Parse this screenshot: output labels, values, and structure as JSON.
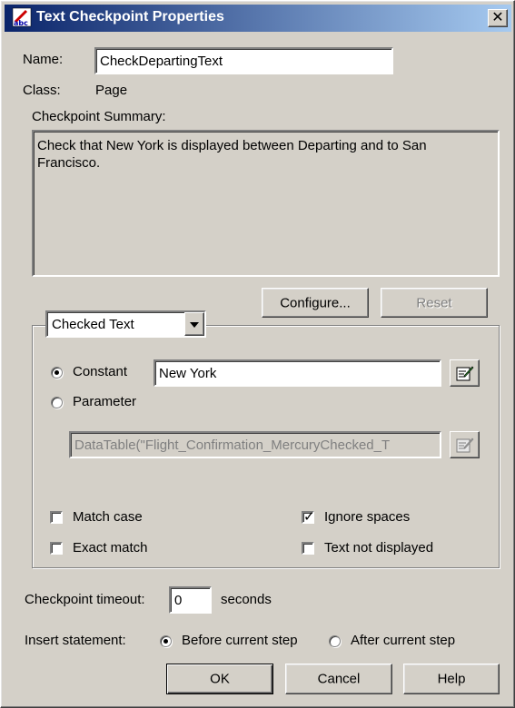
{
  "window": {
    "title": "Text Checkpoint Properties",
    "close_glyph": "✕"
  },
  "name": {
    "label": "Name:",
    "value": "CheckDepartingText"
  },
  "class": {
    "label": "Class:",
    "value": "Page"
  },
  "summary": {
    "label": "Checkpoint Summary:",
    "text": "Check that New York is displayed between Departing and to San Francisco."
  },
  "buttons": {
    "configure": "Configure...",
    "reset": "Reset",
    "ok": "OK",
    "cancel": "Cancel",
    "help": "Help"
  },
  "checked_text": {
    "selected": "Checked Text",
    "constant_label": "Constant",
    "constant_value": "New York",
    "parameter_label": "Parameter",
    "parameter_value": "DataTable(\"Flight_Confirmation_MercuryChecked_T",
    "source": "constant"
  },
  "options": {
    "match_case": {
      "label": "Match case",
      "checked": false
    },
    "exact_match": {
      "label": "Exact match",
      "checked": false
    },
    "ignore_spaces": {
      "label": "Ignore spaces",
      "checked": true
    },
    "text_not_displayed": {
      "label": "Text not displayed",
      "checked": false
    }
  },
  "timeout": {
    "label": "Checkpoint timeout:",
    "value": "0",
    "unit": "seconds"
  },
  "insert": {
    "label": "Insert statement:",
    "before": "Before current step",
    "after": "After current step",
    "selected": "before"
  },
  "icons": {
    "app": "abc-checkpoint-icon",
    "edit": "edit-parameter-icon"
  },
  "colors": {
    "titlebar_start": "#0a246a",
    "titlebar_end": "#a6caf0",
    "face": "#d4d0c8"
  }
}
